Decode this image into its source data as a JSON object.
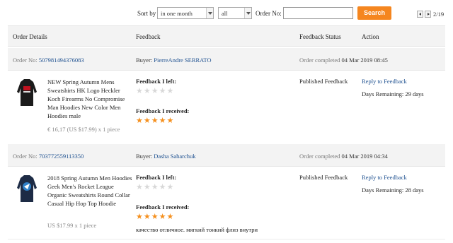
{
  "filters": {
    "sort_label": "Sort by",
    "sort_value": "in one month",
    "type_value": "all",
    "order_label": "Order No:",
    "order_placeholder": "",
    "search_label": "Search",
    "page_text": "2/19"
  },
  "table": {
    "headers": [
      "Order Details",
      "Feedback",
      "Feedback Status",
      "Action"
    ]
  },
  "orders": [
    {
      "order_prefix": "Order No:",
      "order_no": "507981494376083",
      "buyer_prefix": "Buyer:",
      "buyer": "PierreAndre SERRATO",
      "completed_prefix": "Order completed",
      "completed_date": "04 Mar 2019 08:45",
      "title": "NEW Spring Autumn Mens Sweatshirts HK Logo Heckler Koch Firearms No Compromise Man Hoodies New Color Men Hoodies male",
      "price": "€ 16,17 (US $17.99) x 1 piece",
      "left_label": "Feedback I left:",
      "left_stars": 0,
      "received_label": "Feedback I received:",
      "received_stars": 5,
      "comment": "",
      "status": "Published Feedback",
      "reply": "Reply to Feedback",
      "days": "Days Remaining: 29 days"
    },
    {
      "order_prefix": "Order No:",
      "order_no": "703772559113350",
      "buyer_prefix": "Buyer:",
      "buyer": "Dasha Saharchuk",
      "completed_prefix": "Order completed",
      "completed_date": "04 Mar 2019 04:34",
      "title": "2018 Spring Autumn Men Hoodies Geek Men's Rocket League Organic Sweatshirts Round Collar Casual Hip Hop Top Hoodie",
      "price": "US $17.99 x 1 piece",
      "left_label": "Feedback I left:",
      "left_stars": 0,
      "received_label": "Feedback I received:",
      "received_stars": 5,
      "comment": "качество отличное. мягкий тонкий флиз внутри",
      "status": "Published Feedback",
      "reply": "Reply to Feedback",
      "days": "Days Remaining: 28 days"
    }
  ],
  "colors": {
    "accent": "#f5861f",
    "link": "#1c4f8f",
    "star": "#f5901e"
  }
}
